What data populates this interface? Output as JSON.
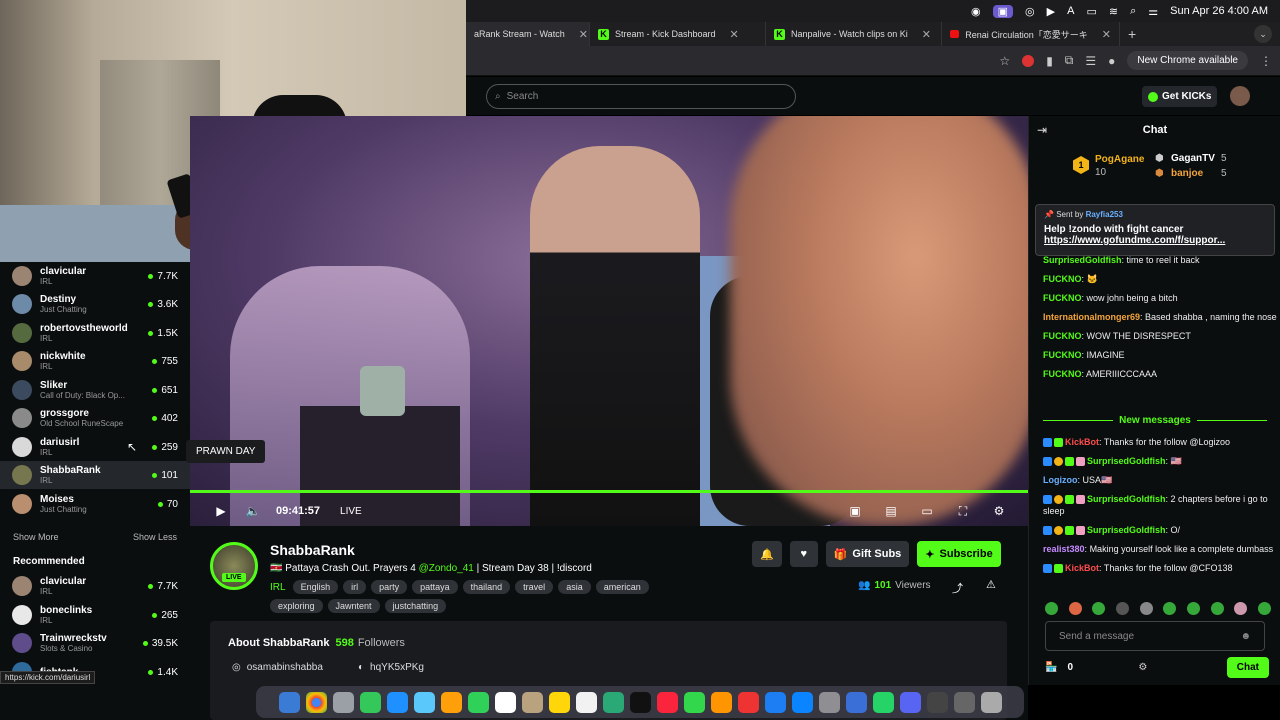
{
  "menubar": {
    "datetime": "Sun Apr 26  4:00 AM"
  },
  "browser": {
    "tabs": [
      {
        "label": "aRank Stream - Watch",
        "icon": "kick-icon"
      },
      {
        "label": "Stream - Kick Dashboard",
        "icon": "kick-icon"
      },
      {
        "label": "Nanpalive - Watch clips on Ki",
        "icon": "kick-icon"
      },
      {
        "label": "Renai Circulation「恋愛サーキ",
        "icon": "youtube-icon"
      }
    ],
    "new_chrome_label": "New Chrome available"
  },
  "nav": {
    "search_placeholder": "Search",
    "get_kicks_label": "Get KICKs"
  },
  "sidebar": {
    "following": [
      {
        "name": "clavicular",
        "category": "IRL",
        "viewers": "7.7K"
      },
      {
        "name": "Destiny",
        "category": "Just Chatting",
        "viewers": "3.6K"
      },
      {
        "name": "robertovstheworld",
        "category": "IRL",
        "viewers": "1.5K"
      },
      {
        "name": "nickwhite",
        "category": "IRL",
        "viewers": "755"
      },
      {
        "name": "Sliker",
        "category": "Call of Duty: Black Op...",
        "viewers": "651"
      },
      {
        "name": "grossgore",
        "category": "Old School RuneScape",
        "viewers": "402"
      },
      {
        "name": "dariusirl",
        "category": "IRL",
        "viewers": "259"
      },
      {
        "name": "ShabbaRank",
        "category": "IRL",
        "viewers": "101"
      },
      {
        "name": "Moises",
        "category": "Just Chatting",
        "viewers": "70"
      }
    ],
    "show_more": "Show More",
    "show_less": "Show Less",
    "recommended_title": "Recommended",
    "recommended": [
      {
        "name": "clavicular",
        "category": "IRL",
        "viewers": "7.7K"
      },
      {
        "name": "boneclinks",
        "category": "IRL",
        "viewers": "265"
      },
      {
        "name": "Trainwreckstv",
        "category": "Slots & Casino",
        "viewers": "39.5K"
      },
      {
        "name": "fishtank",
        "category": "",
        "viewers": "1.4K"
      }
    ],
    "tooltip": "PRAWN DAY",
    "status_url": "https://kick.com/dariusirl"
  },
  "player": {
    "time": "09:41:57",
    "live_label": "LIVE",
    "progress": 1.0
  },
  "channel": {
    "name": "ShabbaRank",
    "live_badge": "LIVE",
    "title_before": "🇸🇷 Pattaya Crash Out. Prayers 4 ",
    "title_mention": "@Zondo_41",
    "title_after": " | Stream Day 38 | !discord",
    "category": "IRL",
    "tags": [
      "English",
      "irl",
      "party",
      "pattaya",
      "thailand",
      "travel",
      "asia",
      "american",
      "exploring",
      "Jawntent",
      "justchatting"
    ],
    "gift_subs_label": "Gift Subs",
    "subscribe_label": "Subscribe",
    "viewers_count": "101",
    "viewers_label": "Viewers",
    "about_title": "About ShabbaRank",
    "followers_count": "598",
    "followers_label": "Followers",
    "instagram": "osamabinshabba",
    "discord": "hqYK5xPKg"
  },
  "chat": {
    "title": "Chat",
    "leaderboard": [
      {
        "name": "PogAgane",
        "count": "10"
      },
      {
        "name": "GaganTV",
        "count": "5"
      },
      {
        "name": "banjoe",
        "count": "5"
      }
    ],
    "pinned": {
      "sent_by_label": "Sent by",
      "sender": "Rayfia253",
      "message": "Help !zondo with fight cancer",
      "url": "https://www.gofundme.com/f/suppor..."
    },
    "messages": [
      {
        "user": "SurprisedGoldfish",
        "text": "time to reel it back",
        "color": "#53fc18"
      },
      {
        "user": "FUCKNO",
        "text": "",
        "color": "#53fc18"
      },
      {
        "user": "FUCKNO",
        "text": "wow john being a bitch",
        "color": "#53fc18"
      },
      {
        "user": "Internationalmonger69",
        "text": "Based shabba , naming the nose",
        "color": "#f3a43b"
      },
      {
        "user": "FUCKNO",
        "text": "WOW THE DISRESPECT",
        "color": "#53fc18"
      },
      {
        "user": "FUCKNO",
        "text": "IMAGINE",
        "color": "#53fc18"
      },
      {
        "user": "FUCKNO",
        "text": "AMERIIICCCAAA",
        "color": "#53fc18"
      }
    ],
    "new_messages_label": "New messages",
    "new_messages": [
      {
        "user": "KickBot",
        "text": "Thanks for the follow @Logizoo",
        "color": "#ff4d4d"
      },
      {
        "user": "SurprisedGoldfish",
        "text": "🇺🇸",
        "color": "#53fc18"
      },
      {
        "user": "Logizoo",
        "text": "USA🇺🇸",
        "color": "#6ab0ff"
      },
      {
        "user": "SurprisedGoldfish",
        "text": "2 chapters before i go to sleep",
        "color": "#53fc18"
      },
      {
        "user": "SurprisedGoldfish",
        "text": "O/",
        "color": "#53fc18"
      },
      {
        "user": "realist380",
        "text": "Making yourself look like a complete dumbass",
        "color": "#c58bff"
      },
      {
        "user": "KickBot",
        "text": "Thanks for the follow @CFO138",
        "color": "#ff4d4d"
      }
    ],
    "input_placeholder": "Send a message",
    "kicks_count": "0",
    "send_label": "Chat"
  }
}
